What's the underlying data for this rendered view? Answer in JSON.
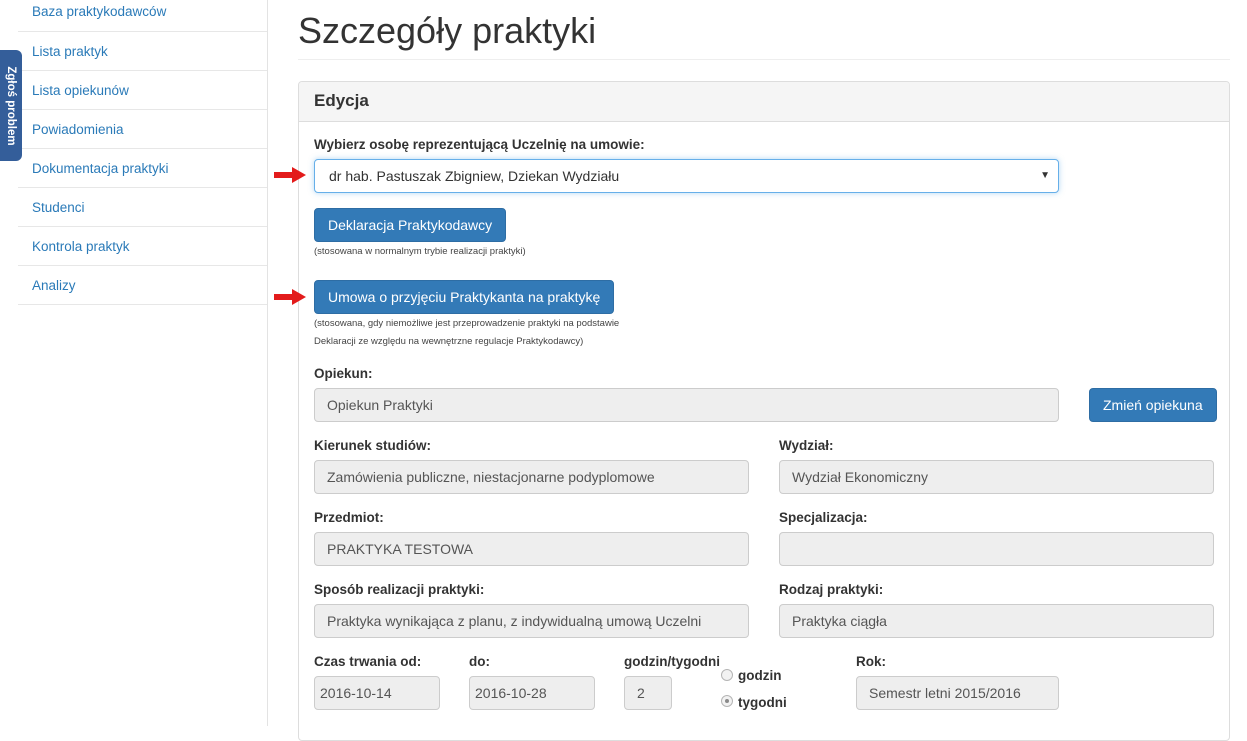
{
  "sidebar": {
    "items": [
      {
        "label": "Baza praktykodawców"
      },
      {
        "label": "Lista praktyk"
      },
      {
        "label": "Lista opiekunów"
      },
      {
        "label": "Powiadomienia"
      },
      {
        "label": "Dokumentacja praktyki"
      },
      {
        "label": "Studenci"
      },
      {
        "label": "Kontrola praktyk"
      },
      {
        "label": "Analizy"
      }
    ],
    "report_tab": "Zgłoś problem"
  },
  "page": {
    "title": "Szczegóły praktyki",
    "panel_title": "Edycja"
  },
  "form": {
    "representative_label": "Wybierz osobę reprezentującą Uczelnię na umowie:",
    "representative_value": "dr hab. Pastuszak Zbigniew, Dziekan Wydziału",
    "declaration_button": "Deklaracja Praktykodawcy",
    "declaration_note": "(stosowana w normalnym trybie realizacji praktyki)",
    "agreement_button": "Umowa o przyjęciu Praktykanta na praktykę",
    "agreement_note_1": "(stosowana, gdy niemożliwe jest przeprowadzenie praktyki na podstawie",
    "agreement_note_2": "Deklaracji ze względu na wewnętrzne regulacje Praktykodawcy)",
    "supervisor_label": "Opiekun:",
    "supervisor_value": "Opiekun Praktyki",
    "change_supervisor_button": "Zmień opiekuna",
    "field_of_study_label": "Kierunek studiów:",
    "field_of_study_value": "Zamówienia publiczne, niestacjonarne podyplomowe",
    "faculty_label": "Wydział:",
    "faculty_value": "Wydział Ekonomiczny",
    "subject_label": "Przedmiot:",
    "subject_value": "PRAKTYKA TESTOWA",
    "specialization_label": "Specjalizacja:",
    "specialization_value": "",
    "realization_label": "Sposób realizacji praktyki:",
    "realization_value": "Praktyka wynikająca z planu, z indywidualną umową Uczelni",
    "type_label": "Rodzaj praktyki:",
    "type_value": "Praktyka ciągła",
    "duration_from_label": "Czas trwania od:",
    "duration_from_value": "2016-10-14",
    "duration_to_label": "do:",
    "duration_to_value": "2016-10-28",
    "hours_label": "godzin/tygodni",
    "hours_value": "2",
    "radio_hours_label": "godzin",
    "radio_weeks_label": "tygodni",
    "radio_selected": "tygodni",
    "year_label": "Rok:",
    "year_value": "Semestr letni 2015/2016"
  },
  "colors": {
    "primary": "#337ab7",
    "link": "#2a7ab8",
    "report_tab": "#345e9a",
    "arrow": "#e31b1b"
  }
}
